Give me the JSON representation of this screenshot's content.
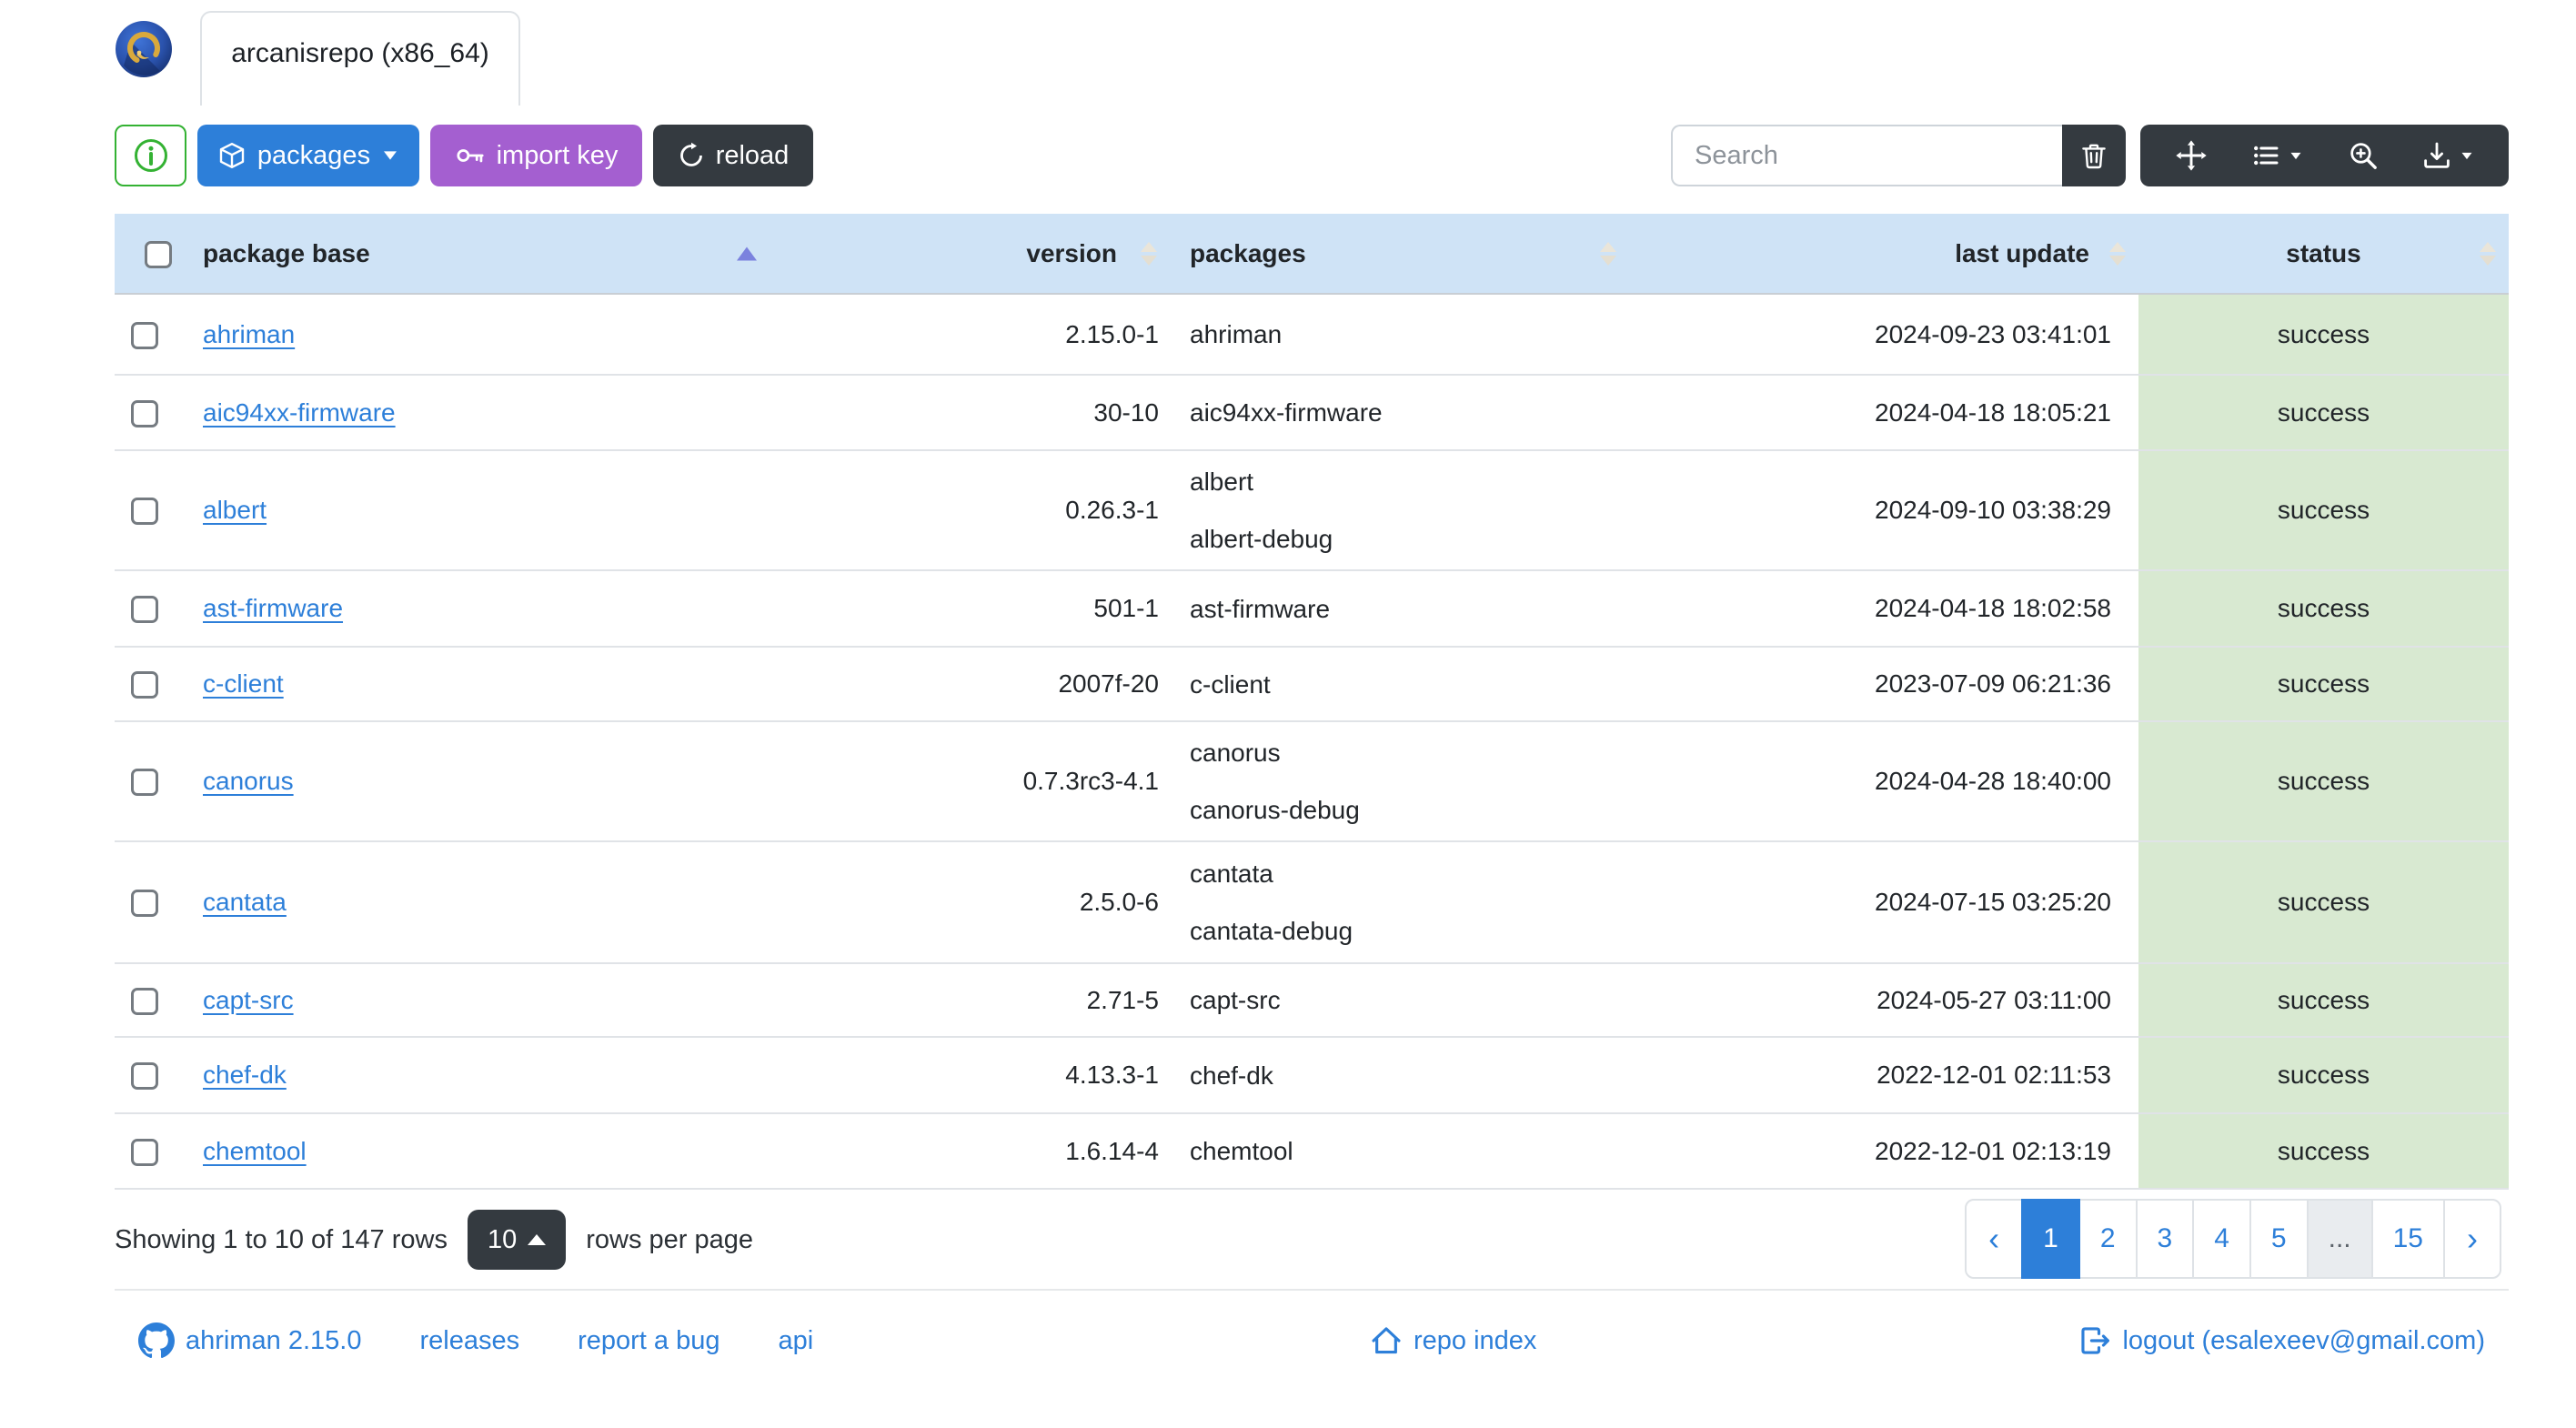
{
  "header": {
    "tab_title": "arcanisrepo (x86_64)"
  },
  "toolbar": {
    "info_icon": "info-circle",
    "packages_label": "packages",
    "import_key_label": "import key",
    "reload_label": "reload",
    "search_placeholder": "Search",
    "icons": [
      "box",
      "caret-down",
      "key",
      "arrow-clockwise",
      "trash",
      "arrows-move",
      "list-columns",
      "zoom-in",
      "download"
    ]
  },
  "table": {
    "columns": [
      {
        "label": "package base",
        "sort": "asc"
      },
      {
        "label": "version",
        "sort": "none"
      },
      {
        "label": "packages",
        "sort": "none"
      },
      {
        "label": "last update",
        "sort": "none"
      },
      {
        "label": "status",
        "sort": "none"
      }
    ],
    "sort": {
      "column": "package base",
      "direction": "ascending"
    },
    "rows": [
      {
        "base": "ahriman",
        "version": "2.15.0-1",
        "packages": [
          "ahriman"
        ],
        "last_update": "2024-09-23 03:41:01",
        "status": "success"
      },
      {
        "base": "aic94xx-firmware",
        "version": "30-10",
        "packages": [
          "aic94xx-firmware"
        ],
        "last_update": "2024-04-18 18:05:21",
        "status": "success"
      },
      {
        "base": "albert",
        "version": "0.26.3-1",
        "packages": [
          "albert",
          "albert-debug"
        ],
        "last_update": "2024-09-10 03:38:29",
        "status": "success"
      },
      {
        "base": "ast-firmware",
        "version": "501-1",
        "packages": [
          "ast-firmware"
        ],
        "last_update": "2024-04-18 18:02:58",
        "status": "success"
      },
      {
        "base": "c-client",
        "version": "2007f-20",
        "packages": [
          "c-client"
        ],
        "last_update": "2023-07-09 06:21:36",
        "status": "success"
      },
      {
        "base": "canorus",
        "version": "0.7.3rc3-4.1",
        "packages": [
          "canorus",
          "canorus-debug"
        ],
        "last_update": "2024-04-28 18:40:00",
        "status": "success"
      },
      {
        "base": "cantata",
        "version": "2.5.0-6",
        "packages": [
          "cantata",
          "cantata-debug"
        ],
        "last_update": "2024-07-15 03:25:20",
        "status": "success"
      },
      {
        "base": "capt-src",
        "version": "2.71-5",
        "packages": [
          "capt-src"
        ],
        "last_update": "2024-05-27 03:11:00",
        "status": "success"
      },
      {
        "base": "chef-dk",
        "version": "4.13.3-1",
        "packages": [
          "chef-dk"
        ],
        "last_update": "2022-12-01 02:11:53",
        "status": "success"
      },
      {
        "base": "chemtool",
        "version": "1.6.14-4",
        "packages": [
          "chemtool"
        ],
        "last_update": "2022-12-01 02:13:19",
        "status": "success"
      }
    ]
  },
  "pagination": {
    "summary": "Showing 1 to 10 of 147 rows",
    "page_size": "10",
    "per_page_label": "rows per page",
    "pages": [
      {
        "label": "‹"
      },
      {
        "label": "1",
        "active": true
      },
      {
        "label": "2"
      },
      {
        "label": "3"
      },
      {
        "label": "4"
      },
      {
        "label": "5"
      },
      {
        "label": "...",
        "gap": true
      },
      {
        "label": "15"
      },
      {
        "label": "›"
      }
    ]
  },
  "footer": {
    "version_link": "ahriman 2.15.0",
    "releases": "releases",
    "report_bug": "report a bug",
    "api": "api",
    "repo_index": "repo index",
    "logout": "logout (esalexeev@gmail.com)"
  },
  "colors": {
    "accent_blue": "#2d7fd9",
    "purple": "#a45fd0",
    "dark": "#343a40",
    "success_green_bg": "#d8e9d1",
    "header_blue_bg": "#cfe3f6",
    "info_green": "#34b233",
    "sort_active": "#7b82de"
  }
}
